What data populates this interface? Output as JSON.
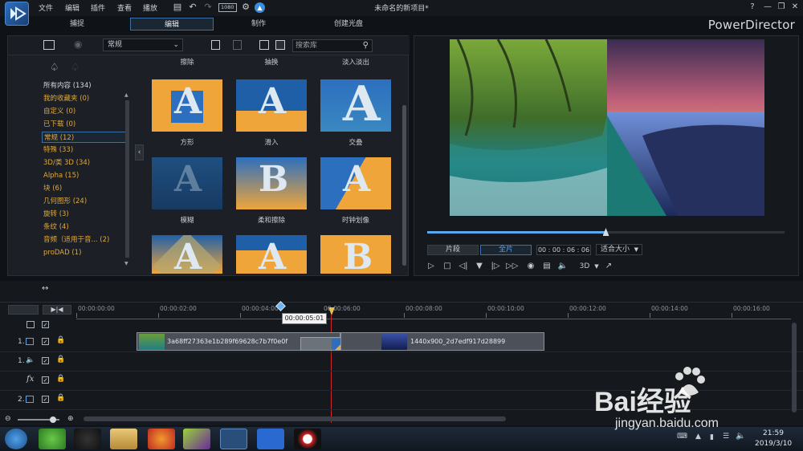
{
  "app": {
    "title": "未命名的新项目*",
    "brand": "PowerDirector"
  },
  "menubar": {
    "items": [
      "文件",
      "编辑",
      "插件",
      "查看",
      "播放"
    ],
    "fps_badge": "1080"
  },
  "modes": {
    "capture": "捕捉",
    "edit": "编辑",
    "produce": "制作",
    "disc": "创建光盘"
  },
  "library": {
    "dropdown_value": "常规",
    "search_placeholder": "搜索库",
    "categories": [
      {
        "label": "所有内容 (134)",
        "color": "white"
      },
      {
        "label": "我的收藏夹  (0)",
        "color": "orange"
      },
      {
        "label": "自定义  (0)",
        "color": "orange"
      },
      {
        "label": "已下载  (0)",
        "color": "orange"
      },
      {
        "label": "常规  (12)",
        "color": "orange",
        "selected": true
      },
      {
        "label": "特殊  (33)",
        "color": "orange"
      },
      {
        "label": "3D/类 3D  (34)",
        "color": "orange"
      },
      {
        "label": "Alpha  (15)",
        "color": "orange"
      },
      {
        "label": "块  (6)",
        "color": "orange"
      },
      {
        "label": "几何图形  (24)",
        "color": "orange"
      },
      {
        "label": "旋转  (3)",
        "color": "orange"
      },
      {
        "label": "条纹  (4)",
        "color": "orange"
      },
      {
        "label": "音频（适用于音...  (2)",
        "color": "orange"
      },
      {
        "label": "proDAD  (1)",
        "color": "orange"
      }
    ],
    "top_labels": [
      "擦除",
      "抽换",
      "淡入淡出"
    ],
    "transitions": [
      {
        "label": "方形",
        "letter": "A"
      },
      {
        "label": "滑入",
        "letter": "A"
      },
      {
        "label": "交叠",
        "letter": "A"
      },
      {
        "label": "模糊",
        "letter": "A"
      },
      {
        "label": "柔和擦除",
        "letter": "B"
      },
      {
        "label": "时钟划像",
        "letter": "A"
      },
      {
        "label": "",
        "letter": "A"
      },
      {
        "label": "",
        "letter": "A"
      },
      {
        "label": "",
        "letter": "B"
      }
    ]
  },
  "preview": {
    "mode_clip": "片段",
    "mode_movie": "全片",
    "timecode": "00 : 00 : 06 : 06",
    "fit_label": "适合大小",
    "view_3d": "3D",
    "progress": 0.5
  },
  "timeline": {
    "ruler": [
      "00:00:00:00",
      "00:00:02:00",
      "00:00:04:00",
      "00:00:06:00",
      "00:00:08:00",
      "00:00:10:00",
      "00:00:12:00",
      "00:00:14:00",
      "00:00:16:00"
    ],
    "playhead_tooltip": "00:00:05:01",
    "clip1_name": "3a68ff27363e1b289f69628c7b7f0e0f",
    "clip2_name": "1440x900_2d7edf917d28899",
    "track_labels": [
      "1.",
      "1.",
      "2."
    ]
  },
  "taskbar": {
    "time": "21:59",
    "date": "2019/3/10"
  },
  "watermark": {
    "logo": "Bai经验",
    "url": "jingyan.baidu.com"
  },
  "colors": {
    "accent_blue": "#3c6fa5",
    "category_orange": "#e0a83c",
    "playhead_red": "#d0282a"
  }
}
